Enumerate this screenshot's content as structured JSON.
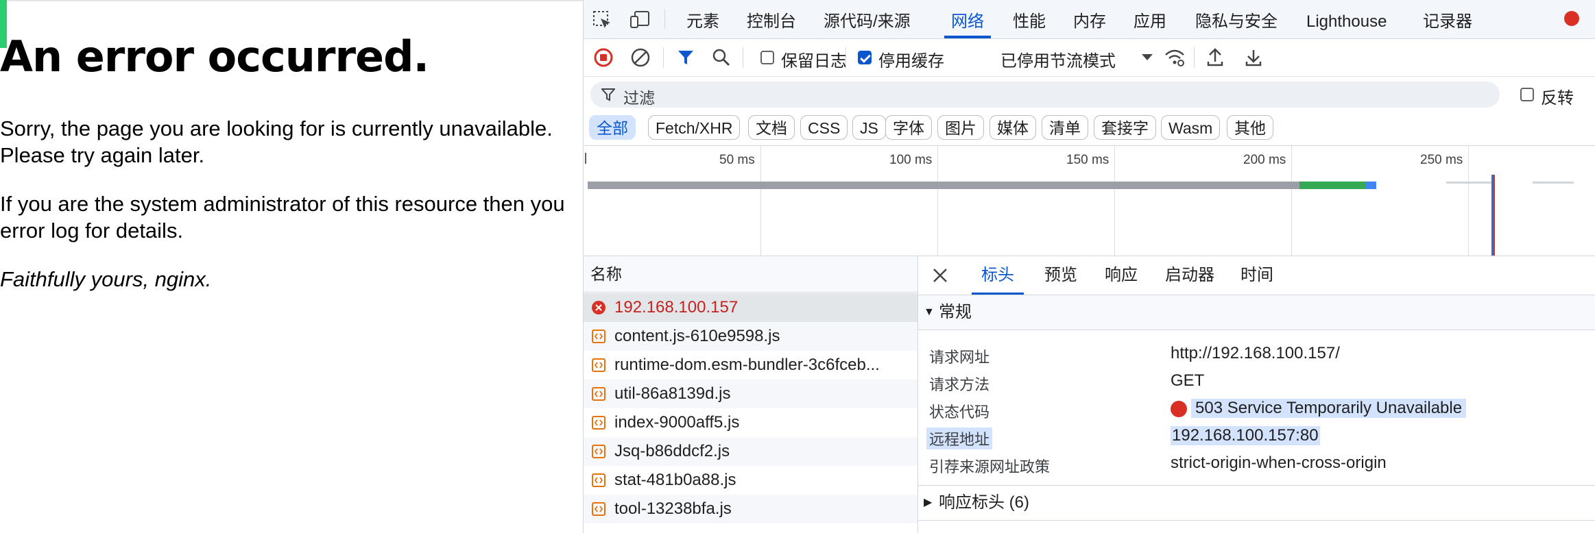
{
  "page": {
    "heading": "An error occurred.",
    "para1_line1": "Sorry, the page you are looking for is currently unavailable.",
    "para1_line2": "Please try again later.",
    "para2_line1": "If you are the system administrator of this resource then you",
    "para2_line2": "error log for details.",
    "signature": "Faithfully yours, nginx."
  },
  "devtools": {
    "tabs": [
      "元素",
      "控制台",
      "源代码/来源",
      "网络",
      "性能",
      "内存",
      "应用",
      "隐私与安全",
      "Lighthouse",
      "记录器"
    ],
    "active_tab": "网络",
    "toolbar": {
      "preserve_log_label": "保留日志",
      "preserve_log_checked": false,
      "disable_cache_label": "停用缓存",
      "disable_cache_checked": true,
      "throttle_value": "已停用节流模式"
    },
    "filter": {
      "placeholder": "过滤",
      "invert_label": "反转",
      "invert_checked": false
    },
    "type_filters": [
      "全部",
      "Fetch/XHR",
      "文档",
      "CSS",
      "JS",
      "字体",
      "图片",
      "媒体",
      "清单",
      "套接字",
      "Wasm",
      "其他"
    ],
    "active_type_filter": "全部",
    "timeline": {
      "ticks": [
        "50 ms",
        "100 ms",
        "150 ms",
        "200 ms",
        "250 ms"
      ]
    },
    "request_list": {
      "header": "名称",
      "requests": [
        {
          "name": "192.168.100.157",
          "status": "error"
        },
        {
          "name": "content.js-610e9598.js",
          "status": "ok"
        },
        {
          "name": "runtime-dom.esm-bundler-3c6fceb...",
          "status": "ok"
        },
        {
          "name": "util-86a8139d.js",
          "status": "ok"
        },
        {
          "name": "index-9000aff5.js",
          "status": "ok"
        },
        {
          "name": "Jsq-b86ddcf2.js",
          "status": "ok"
        },
        {
          "name": "stat-481b0a88.js",
          "status": "ok"
        },
        {
          "name": "tool-13238bfa.js",
          "status": "ok"
        }
      ]
    },
    "detail_tabs": [
      "标头",
      "预览",
      "响应",
      "启动器",
      "时间"
    ],
    "active_detail_tab": "标头",
    "general": {
      "title": "常规",
      "rows": [
        {
          "key": "请求网址",
          "value": "http://192.168.100.157/"
        },
        {
          "key": "请求方法",
          "value": "GET"
        },
        {
          "key": "状态代码",
          "value": "503 Service Temporarily Unavailable"
        },
        {
          "key": "远程地址",
          "value": "192.168.100.157:80"
        },
        {
          "key": "引荐来源网址政策",
          "value": "strict-origin-when-cross-origin"
        }
      ]
    },
    "response_headers_title": "响应标头 (6)",
    "colors": {
      "accent": "#0b57d0",
      "error": "#d93025",
      "waterfall_gray": "#9aa0a6",
      "waterfall_green": "#34a853",
      "waterfall_blue": "#4285f4"
    }
  }
}
